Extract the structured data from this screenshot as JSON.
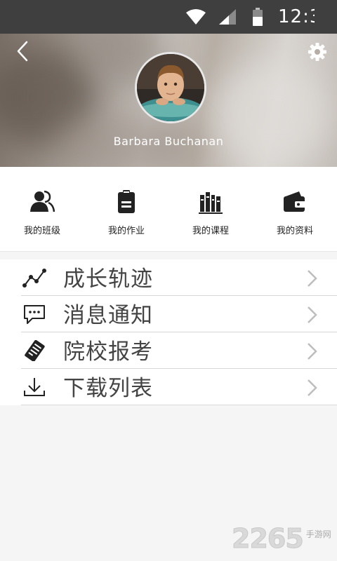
{
  "status_bar": {
    "time": "12:3",
    "icons": [
      "wifi-icon",
      "signal-icon",
      "battery-icon"
    ]
  },
  "header": {
    "back_icon": "chevron-left-icon",
    "settings_icon": "gear-icon",
    "username": "Barbara Buchanan"
  },
  "quick_grid": [
    {
      "icon": "people-icon",
      "label": "我的班级"
    },
    {
      "icon": "clipboard-icon",
      "label": "我的作业"
    },
    {
      "icon": "books-icon",
      "label": "我的课程"
    },
    {
      "icon": "wallet-icon",
      "label": "我的资料"
    }
  ],
  "menu": [
    {
      "icon": "trend-line-icon",
      "label": "成长轨迹"
    },
    {
      "icon": "chat-bubble-icon",
      "label": "消息通知"
    },
    {
      "icon": "document-icon",
      "label": "院校报考"
    },
    {
      "icon": "download-icon",
      "label": "下载列表"
    }
  ],
  "watermark": {
    "number": "2265",
    "text": "手游网"
  },
  "colors": {
    "status_bar": "#3f3f3f",
    "background": "#f5f5f5",
    "text_dark": "#222222",
    "menu_text": "#444444"
  }
}
